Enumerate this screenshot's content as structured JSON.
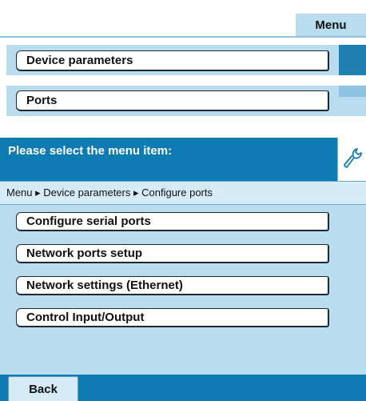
{
  "top_menu": {
    "label": "Menu"
  },
  "upper_menu": {
    "items": [
      {
        "label": "Device parameters"
      },
      {
        "label": "Ports"
      }
    ]
  },
  "dialog": {
    "title": "Please select the menu item:",
    "breadcrumb": "Menu ▸ Device parameters ▸ Configure ports",
    "options": [
      {
        "label": "Configure serial ports"
      },
      {
        "label": "Network ports setup"
      },
      {
        "label": "Network settings (Ethernet)"
      },
      {
        "label": "Control Input/Output"
      }
    ],
    "icon": "wrench-icon"
  },
  "footer": {
    "back_label": "Back"
  },
  "colors": {
    "header_blue": "#0f7bb3",
    "panel_light_blue": "#b9dcef",
    "breadcrumb_bg": "#d5ebf7"
  }
}
